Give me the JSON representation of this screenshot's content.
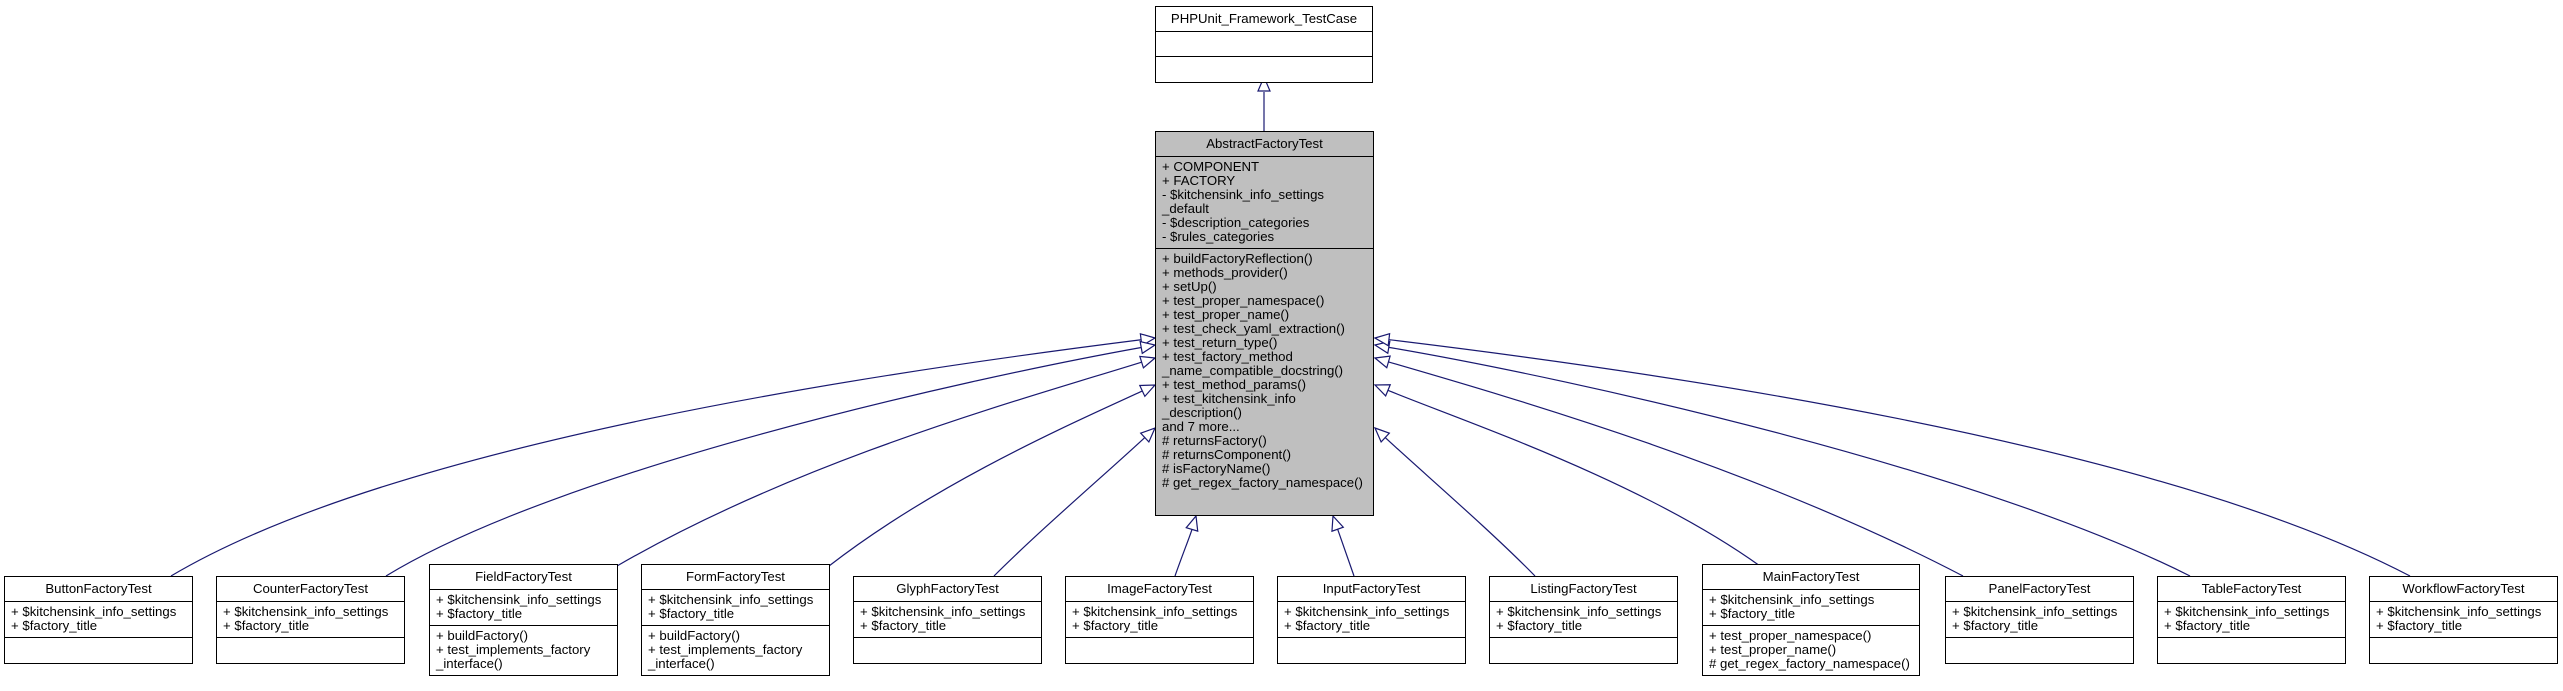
{
  "diagram": {
    "type": "uml-class-inheritance",
    "root": {
      "name": "PHPUnit_Framework_TestCase",
      "attributes": [],
      "methods": []
    },
    "base": {
      "name": "AbstractFactoryTest",
      "attributes": [
        "+ COMPONENT",
        "+ FACTORY",
        "- $kitchensink_info_settings",
        "_default",
        "- $description_categories",
        "- $rules_categories"
      ],
      "methods": [
        "+ buildFactoryReflection()",
        "+ methods_provider()",
        "+ setUp()",
        "+ test_proper_namespace()",
        "+ test_proper_name()",
        "+ test_check_yaml_extraction()",
        "+ test_return_type()",
        "+ test_factory_method",
        "_name_compatible_docstring()",
        "+ test_method_params()",
        "+ test_kitchensink_info",
        "_description()",
        "and 7 more...",
        "# returnsFactory()",
        "# returnsComponent()",
        "# isFactoryName()",
        "# get_regex_factory_namespace()"
      ]
    },
    "children": [
      {
        "name": "ButtonFactoryTest",
        "attributes": [
          "+ $kitchensink_info_settings",
          "+ $factory_title"
        ],
        "methods": []
      },
      {
        "name": "CounterFactoryTest",
        "attributes": [
          "+ $kitchensink_info_settings",
          "+ $factory_title"
        ],
        "methods": []
      },
      {
        "name": "FieldFactoryTest",
        "attributes": [
          "+ $kitchensink_info_settings",
          "+ $factory_title"
        ],
        "methods": [
          "+ buildFactory()",
          "+ test_implements_factory",
          "_interface()"
        ]
      },
      {
        "name": "FormFactoryTest",
        "attributes": [
          "+ $kitchensink_info_settings",
          "+ $factory_title"
        ],
        "methods": [
          "+ buildFactory()",
          "+ test_implements_factory",
          "_interface()"
        ]
      },
      {
        "name": "GlyphFactoryTest",
        "attributes": [
          "+ $kitchensink_info_settings",
          "+ $factory_title"
        ],
        "methods": []
      },
      {
        "name": "ImageFactoryTest",
        "attributes": [
          "+ $kitchensink_info_settings",
          "+ $factory_title"
        ],
        "methods": []
      },
      {
        "name": "InputFactoryTest",
        "attributes": [
          "+ $kitchensink_info_settings",
          "+ $factory_title"
        ],
        "methods": []
      },
      {
        "name": "ListingFactoryTest",
        "attributes": [
          "+ $kitchensink_info_settings",
          "+ $factory_title"
        ],
        "methods": []
      },
      {
        "name": "MainFactoryTest",
        "attributes": [
          "+ $kitchensink_info_settings",
          "+ $factory_title"
        ],
        "methods": [
          "+ test_proper_namespace()",
          "+ test_proper_name()",
          "# get_regex_factory_namespace()"
        ]
      },
      {
        "name": "PanelFactoryTest",
        "attributes": [
          "+ $kitchensink_info_settings",
          "+ $factory_title"
        ],
        "methods": []
      },
      {
        "name": "TableFactoryTest",
        "attributes": [
          "+ $kitchensink_info_settings",
          "+ $factory_title"
        ],
        "methods": []
      },
      {
        "name": "WorkflowFactoryTest",
        "attributes": [
          "+ $kitchensink_info_settings",
          "+ $factory_title"
        ],
        "methods": []
      }
    ],
    "colors": {
      "edge": "#191970",
      "base_fill": "#bfbfbf",
      "box_fill": "#ffffff",
      "border": "#000000"
    }
  }
}
